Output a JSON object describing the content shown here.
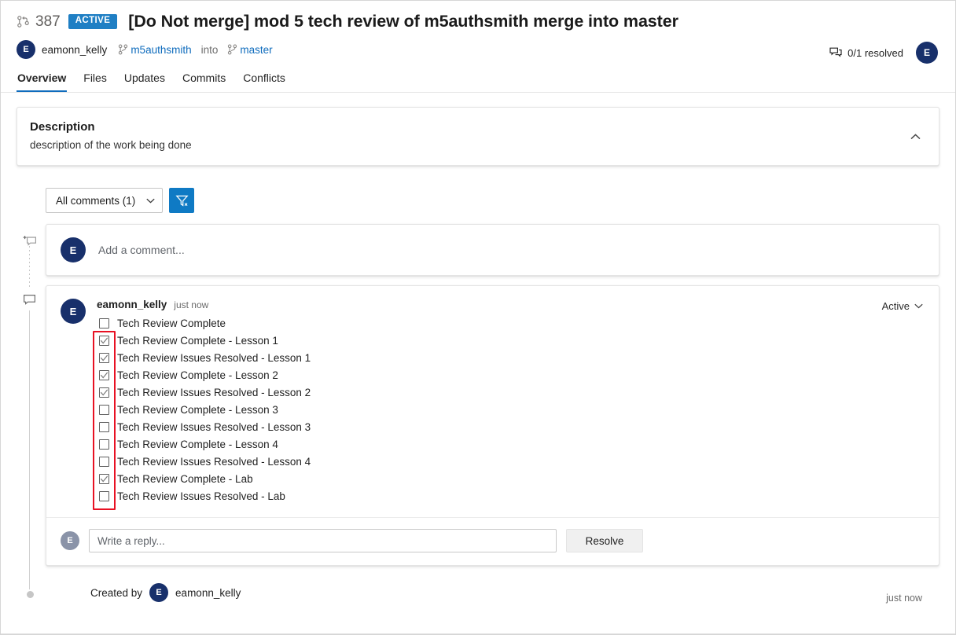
{
  "header": {
    "pr_icon": "pull-request-icon",
    "pr_number": "387",
    "status_badge": "ACTIVE",
    "title": "[Do Not merge] mod 5 tech review of m5authsmith merge into master",
    "author": "eamonn_kelly",
    "author_initial": "E",
    "source_branch": "m5authsmith",
    "into_word": "into",
    "target_branch": "master",
    "resolved_icon": "comments-icon",
    "resolved_text": "0/1 resolved",
    "user_initial": "E",
    "accent_color": "#0f6cbd",
    "badge_color": "#1f7fc4"
  },
  "tabs": [
    {
      "label": "Overview",
      "selected": true
    },
    {
      "label": "Files",
      "selected": false
    },
    {
      "label": "Updates",
      "selected": false
    },
    {
      "label": "Commits",
      "selected": false
    },
    {
      "label": "Conflicts",
      "selected": false
    }
  ],
  "description": {
    "title": "Description",
    "body": "description of the work being done",
    "collapse_icon": "chevron-up-icon"
  },
  "filter": {
    "select_label": "All comments (1)",
    "select_chevron": "chevron-down-icon",
    "button_icon": "filter-clear-icon",
    "button_color": "#0f7ac4"
  },
  "add_comment": {
    "avatar_initial": "E",
    "placeholder": "Add a comment..."
  },
  "thread": {
    "avatar_initial": "E",
    "user": "eamonn_kelly",
    "time": "just now",
    "status_label": "Active",
    "status_chevron": "chevron-down-icon",
    "highlight_color": "#e81123",
    "items": [
      {
        "checked": false,
        "label": "Tech Review Complete"
      },
      {
        "checked": true,
        "label": "Tech Review Complete - Lesson 1"
      },
      {
        "checked": true,
        "label": "Tech Review Issues Resolved - Lesson 1"
      },
      {
        "checked": true,
        "label": "Tech Review Complete - Lesson 2"
      },
      {
        "checked": true,
        "label": "Tech Review Issues Resolved - Lesson 2"
      },
      {
        "checked": false,
        "label": "Tech Review Complete - Lesson 3"
      },
      {
        "checked": false,
        "label": "Tech Review Issues Resolved - Lesson 3"
      },
      {
        "checked": false,
        "label": "Tech Review Complete - Lesson 4"
      },
      {
        "checked": false,
        "label": "Tech Review Issues Resolved - Lesson 4"
      },
      {
        "checked": true,
        "label": "Tech Review Complete - Lab"
      },
      {
        "checked": false,
        "label": "Tech Review Issues Resolved - Lab"
      }
    ],
    "reply": {
      "avatar_initial": "E",
      "placeholder": "Write a reply...",
      "resolve_label": "Resolve"
    }
  },
  "rail": {
    "add_icon": "add-comment-icon",
    "bubble_icon": "comment-bubble-icon"
  },
  "footer": {
    "created_by_label": "Created by",
    "avatar_initial": "E",
    "author": "eamonn_kelly",
    "time": "just now"
  }
}
